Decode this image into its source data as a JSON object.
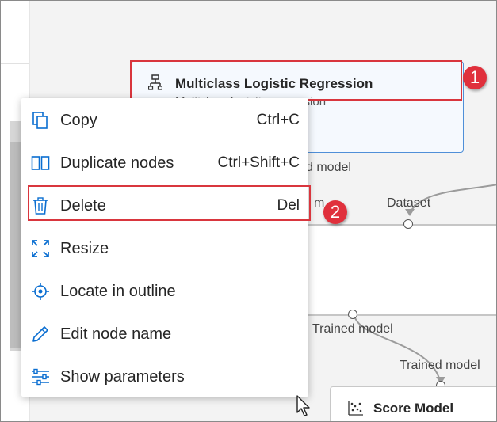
{
  "nodes": {
    "mlr": {
      "title": "Multiclass Logistic Regression",
      "subtitle": "Multiclass logistic regression"
    },
    "score": {
      "title": "Score Model"
    }
  },
  "ports": {
    "untrained_model": "Untrained model",
    "untrained_model_clipped": "d model",
    "clipped_left": "m",
    "dataset": "Dataset",
    "trained_model_out": "Trained model",
    "trained_model_in": "Trained model"
  },
  "context_menu": {
    "items": [
      {
        "label": "Copy",
        "shortcut": "Ctrl+C",
        "icon": "copy-icon"
      },
      {
        "label": "Duplicate nodes",
        "shortcut": "Ctrl+Shift+C",
        "icon": "duplicate-icon"
      },
      {
        "label": "Delete",
        "shortcut": "Del",
        "icon": "trash-icon"
      },
      {
        "label": "Resize",
        "shortcut": "",
        "icon": "resize-icon"
      },
      {
        "label": "Locate in outline",
        "shortcut": "",
        "icon": "locate-icon"
      },
      {
        "label": "Edit node name",
        "shortcut": "",
        "icon": "pencil-icon"
      },
      {
        "label": "Show parameters",
        "shortcut": "",
        "icon": "sliders-icon"
      }
    ]
  },
  "callouts": {
    "first": "1",
    "second": "2"
  },
  "colors": {
    "accent": "#0078d4",
    "highlight": "#d9363e",
    "badge": "#e0303c"
  }
}
